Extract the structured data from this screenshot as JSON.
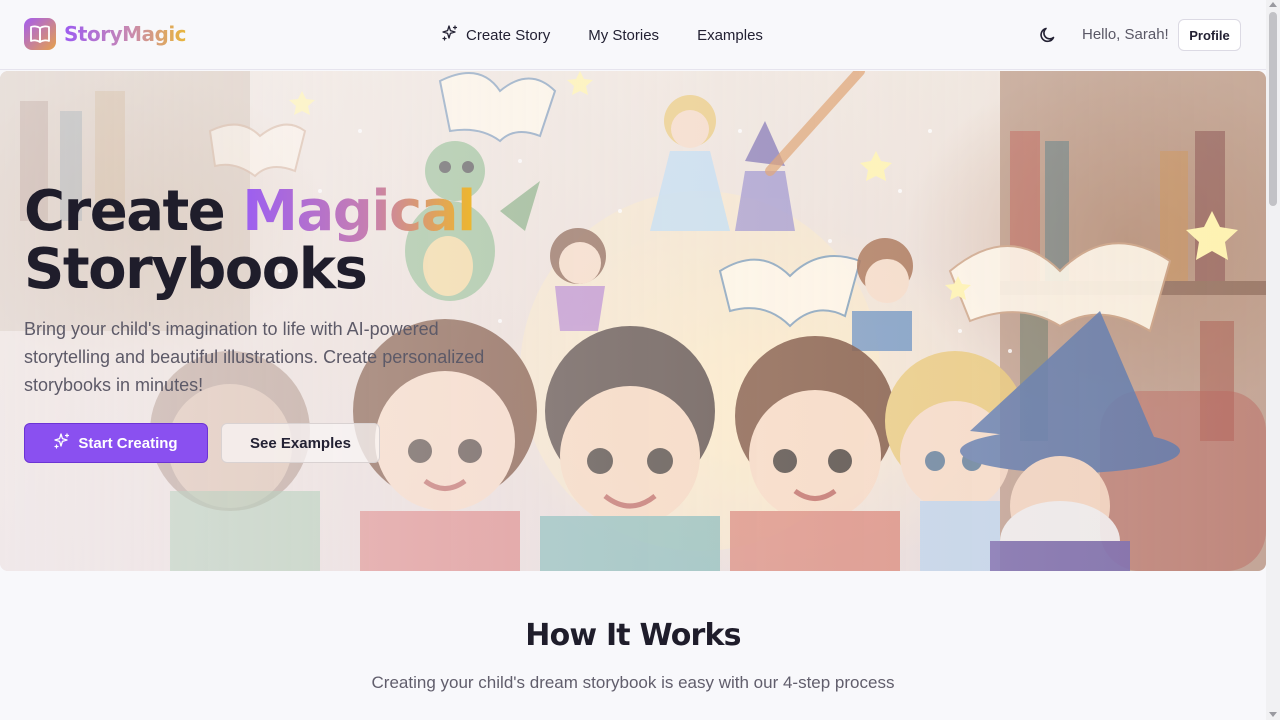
{
  "brand": {
    "name": "StoryMagic",
    "logo_icon": "book-open-icon"
  },
  "nav": {
    "items": [
      {
        "label": "Create Story",
        "icon": "sparkles-icon"
      },
      {
        "label": "My Stories"
      },
      {
        "label": "Examples"
      }
    ]
  },
  "header": {
    "theme_toggle_icon": "moon-icon",
    "greeting": "Hello, Sarah!",
    "profile_label": "Profile"
  },
  "hero": {
    "title_line1_a": "Create ",
    "title_line1_b": "Magical",
    "title_line2": "Storybooks",
    "subtitle": "Bring your child's imagination to life with AI-powered storytelling and beautiful illustrations. Create personalized storybooks in minutes!",
    "primary_button": "Start Creating",
    "primary_button_icon": "sparkles-icon",
    "secondary_button": "See Examples",
    "image": "illustration of children and fairy-tale characters reading books in a library"
  },
  "how_it_works": {
    "title": "How It Works",
    "subtitle": "Creating your child's dream storybook is easy with our 4-step process"
  },
  "colors": {
    "accent": "#8a50f0",
    "gradient_start": "#9b5ef2",
    "gradient_end": "#eeb82b",
    "background": "#f8f8fb"
  }
}
